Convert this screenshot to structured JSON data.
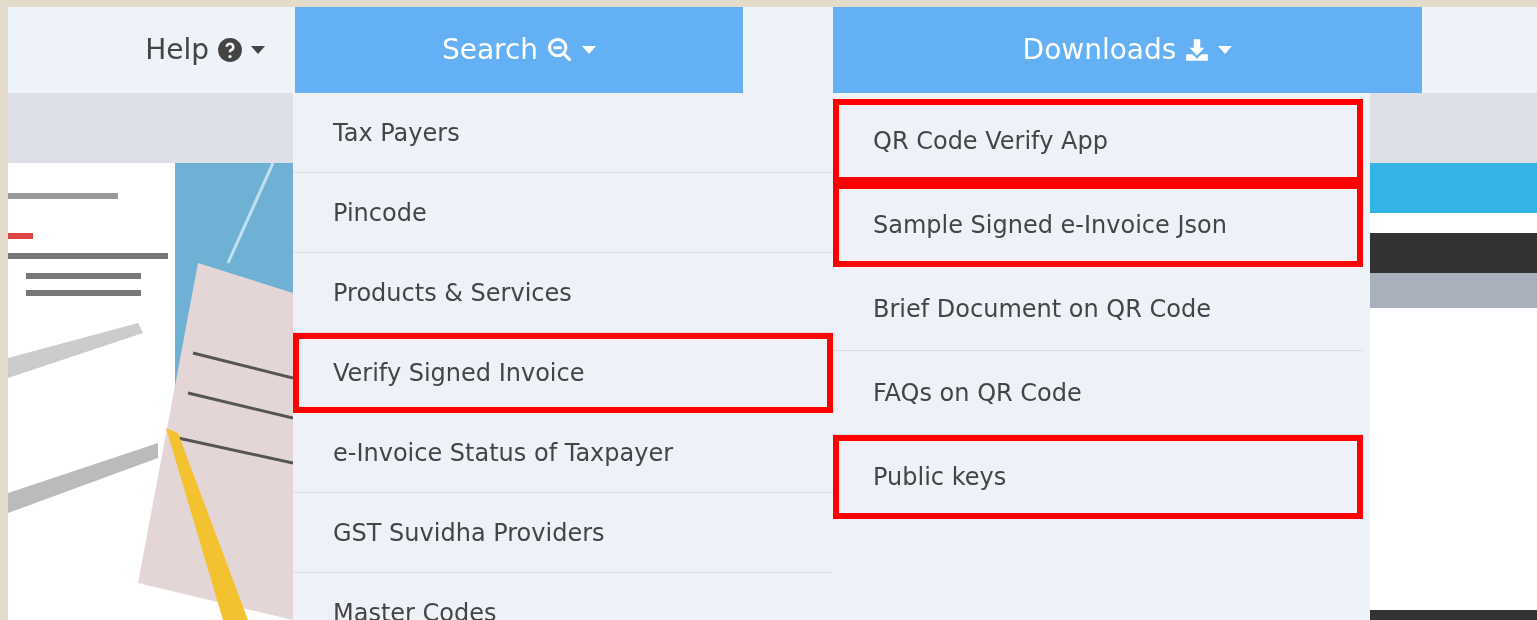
{
  "nav": [
    {
      "label": "Help",
      "selected": false
    },
    {
      "label": "Search",
      "selected": true
    },
    {
      "label": "Downloads",
      "selected": true
    }
  ],
  "search_menu": [
    {
      "label": "Tax Payers",
      "highlighted": false
    },
    {
      "label": "Pincode",
      "highlighted": false
    },
    {
      "label": "Products & Services",
      "highlighted": false
    },
    {
      "label": "Verify Signed Invoice",
      "highlighted": true
    },
    {
      "label": "e-Invoice Status of Taxpayer",
      "highlighted": false
    },
    {
      "label": "GST Suvidha Providers",
      "highlighted": false
    },
    {
      "label": "Master Codes",
      "highlighted": false
    }
  ],
  "downloads_menu": [
    {
      "label": "QR Code Verify App",
      "highlighted": true
    },
    {
      "label": "Sample Signed e-Invoice Json",
      "highlighted": true
    },
    {
      "label": "Brief Document on QR Code",
      "highlighted": false
    },
    {
      "label": "FAQs on QR Code",
      "highlighted": false
    },
    {
      "label": "Public keys",
      "highlighted": true
    }
  ]
}
